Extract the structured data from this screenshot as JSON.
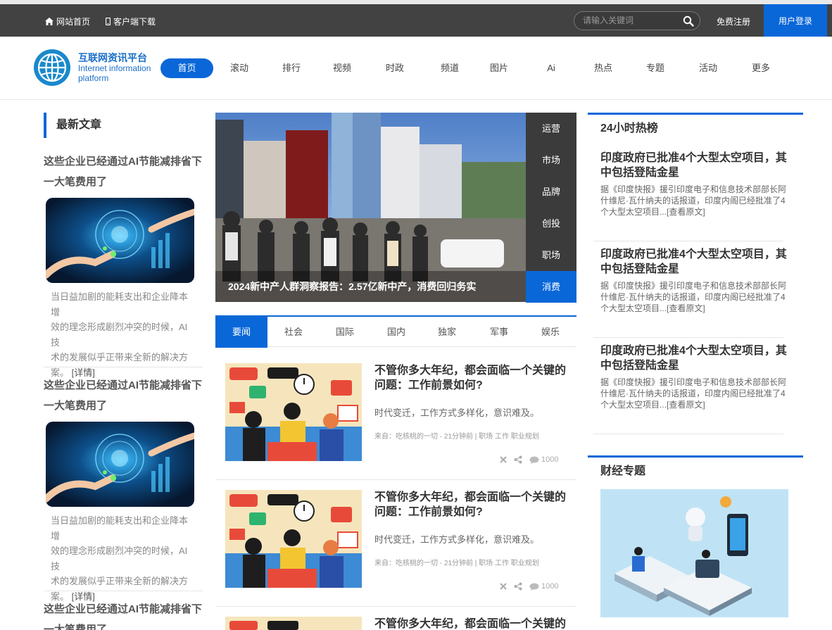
{
  "topbar": {
    "home_label": "网站首页",
    "app_label": "客户端下载",
    "search_placeholder": "请输入关键词",
    "register_label": "免费注册",
    "login_label": "用户登录"
  },
  "brand": {
    "name_cn": "互联网资讯平台",
    "name_en_1": "Internet information",
    "name_en_2": "platform"
  },
  "nav": {
    "items": [
      "首页",
      "滚动",
      "排行",
      "视频",
      "时政",
      "频道",
      "图片",
      "Ai",
      "热点",
      "专题",
      "活动",
      "更多"
    ]
  },
  "left": {
    "section_title": "最新文章",
    "articles": [
      {
        "title_1": "这些企业已经通过AI节能减排省下",
        "title_2": "一大笔费用了",
        "desc_1": "当日益加剧的能耗支出和企业降本增",
        "desc_2": "效的理念形成剧烈冲突的时候，AI技",
        "desc_3": "术的发展似乎正带来全新的解决方",
        "desc_4": "案。",
        "more": "[详情]"
      },
      {
        "title_1": "这些企业已经通过AI节能减排省下",
        "title_2": "一大笔费用了",
        "desc_1": "当日益加剧的能耗支出和企业降本增",
        "desc_2": "效的理念形成剧烈冲突的时候，AI技",
        "desc_3": "术的发展似乎正带来全新的解决方",
        "desc_4": "案。",
        "more": "[详情]"
      },
      {
        "title_1": "这些企业已经通过AI节能减排省下",
        "title_2": "一大笔费用了"
      }
    ]
  },
  "slider": {
    "caption": "2024新中产人群洞察报告：2.57亿新中产，消费回归务实",
    "categories": [
      "运营",
      "市场",
      "品牌",
      "创投",
      "职场",
      "消费"
    ]
  },
  "tabs": [
    "要闻",
    "社会",
    "国际",
    "国内",
    "独家",
    "军事",
    "娱乐"
  ],
  "news": [
    {
      "title_1": "不管你多大年纪，都会面临一个关键的",
      "title_2": "问题：工作前景如何?",
      "desc": "时代变迁，工作方式多样化，意识难及。",
      "meta": "来自：吃核桃的一切 -  21分钟前  |  职场 工作 职业规划",
      "count": "1000"
    },
    {
      "title_1": "不管你多大年纪，都会面临一个关键的",
      "title_2": "问题：工作前景如何?",
      "desc": "时代变迁，工作方式多样化，意识难及。",
      "meta": "来自：吃核桃的一切 -  21分钟前  |  职场 工作 职业规划",
      "count": "1000"
    },
    {
      "title_1": "不管你多大年纪，都会面临一个关键的"
    }
  ],
  "hot": {
    "title": "24小时热榜",
    "items": [
      {
        "title_1": "印度政府已批准4个大型太空项目，其",
        "title_2": "中包括登陆金星",
        "desc_1": "据《印度快报》援引印度电子和信息技术部部长阿",
        "desc_2": "什维尼·瓦什纳夫的话报道，印度内阁已经批准了4",
        "desc_3": "个大型太空项目...[查看原文]"
      },
      {
        "title_1": "印度政府已批准4个大型太空项目，其",
        "title_2": "中包括登陆金星",
        "desc_1": "据《印度快报》援引印度电子和信息技术部部长阿",
        "desc_2": "什维尼·瓦什纳夫的话报道，印度内阁已经批准了4",
        "desc_3": "个大型太空项目...[查看原文]"
      },
      {
        "title_1": "印度政府已批准4个大型太空项目，其",
        "title_2": "中包括登陆金星",
        "desc_1": "据《印度快报》援引印度电子和信息技术部部长阿",
        "desc_2": "什维尼·瓦什纳夫的话报道，印度内阁已经批准了4",
        "desc_3": "个大型太空项目...[查看原文]"
      }
    ]
  },
  "finance": {
    "title": "财经专题"
  },
  "colors": {
    "accent": "#0a67d8",
    "topbar": "#424242"
  },
  "icons": [
    "home-icon",
    "mobile-icon",
    "search-icon",
    "close-icon",
    "share-icon",
    "comment-icon"
  ]
}
